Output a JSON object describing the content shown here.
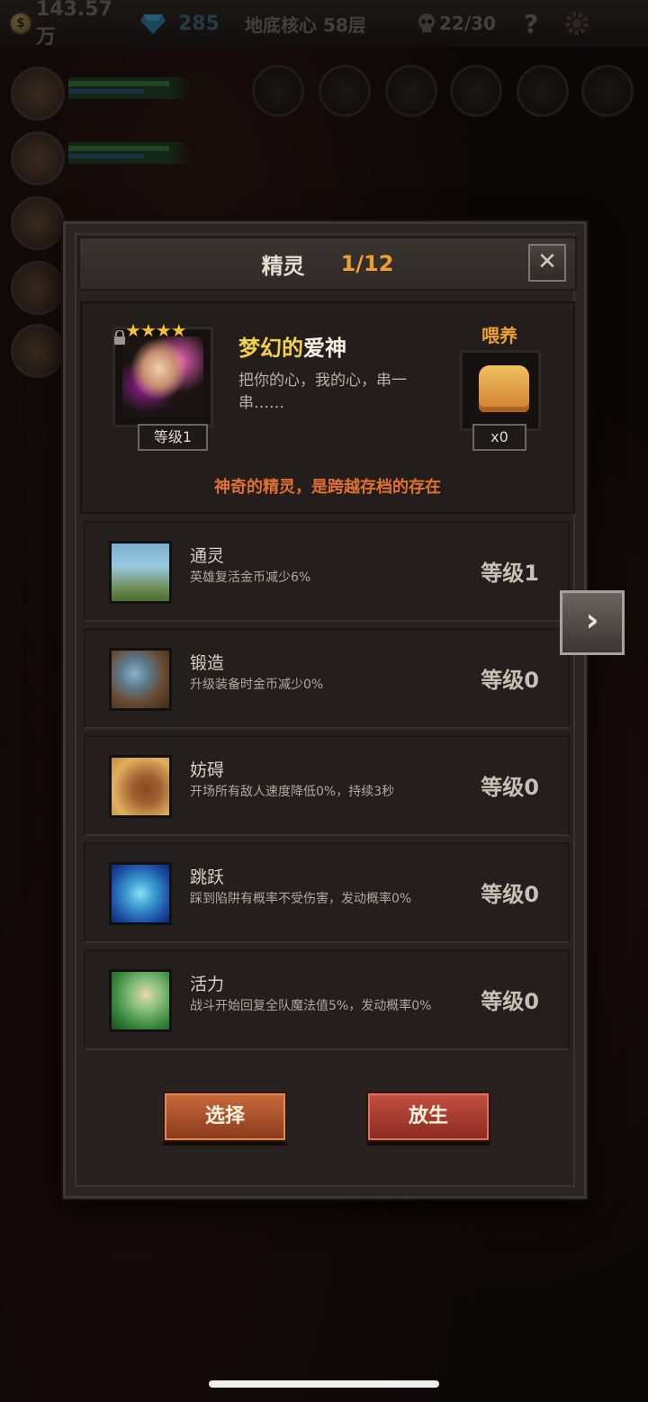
{
  "topbar": {
    "gold": "143.57万",
    "gems": "285",
    "floor": "地底核心 58层",
    "kills": "22/30",
    "help": "?"
  },
  "dialog": {
    "title": "精灵",
    "page": "1/12",
    "close": "✕",
    "sprite": {
      "stars": "★★★★",
      "name_prefix": "梦幻的",
      "name_suffix": "爱神",
      "description": "把你的心，我的心，串一串……",
      "level": "等级1",
      "feed_label": "喂养",
      "feed_count": "x0",
      "tagline": "神奇的精灵，是跨越存档的存在"
    },
    "skills": [
      {
        "name": "通灵",
        "desc": "英雄复活金币减少6%",
        "level": "等级1",
        "icon": "tombstone-icon"
      },
      {
        "name": "锻造",
        "desc": "升级装备时金币减少0%",
        "level": "等级0",
        "icon": "hammer-icon"
      },
      {
        "name": "妨碍",
        "desc": "开场所有敌人速度降低0%，持续3秒",
        "level": "等级0",
        "icon": "chained-boot-icon"
      },
      {
        "name": "跳跃",
        "desc": "踩到陷阱有概率不受伤害，发动概率0%",
        "level": "等级0",
        "icon": "leap-icon"
      },
      {
        "name": "活力",
        "desc": "战斗开始回复全队魔法值5%，发动概率0%",
        "level": "等级0",
        "icon": "vitality-icon"
      }
    ],
    "buttons": {
      "select": "选择",
      "release": "放生"
    },
    "next": "›"
  },
  "colors": {
    "accent_orange": "#f0a030",
    "name_gold": "#f3d24a",
    "tagline": "#e07030"
  }
}
